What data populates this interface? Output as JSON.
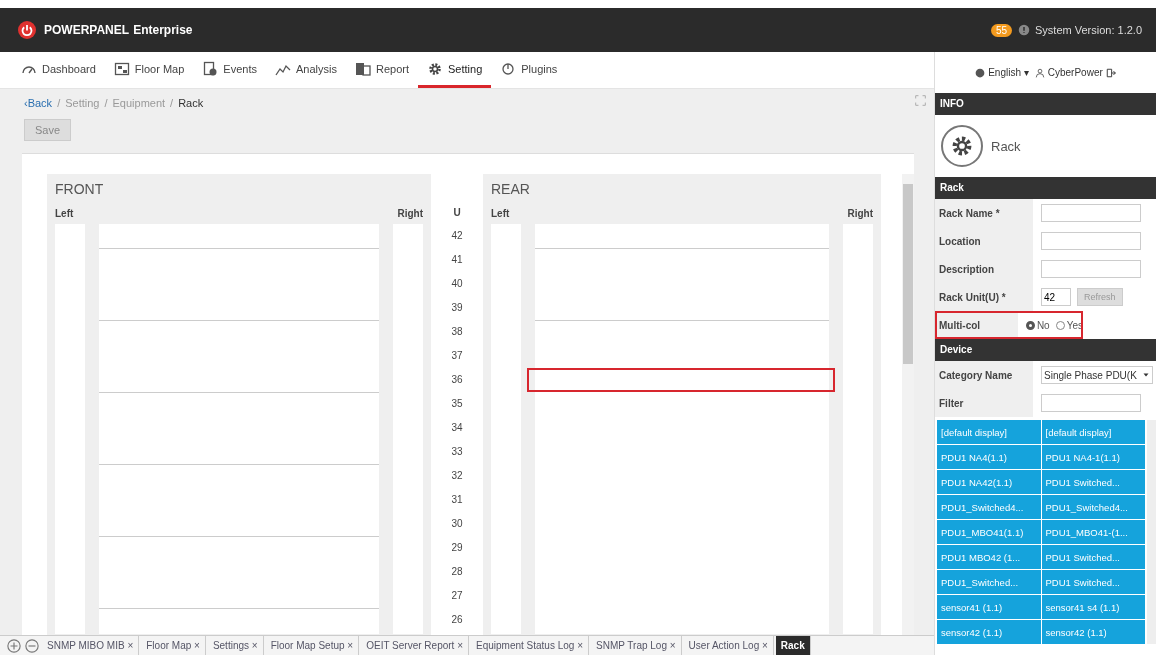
{
  "header": {
    "brand": "POWERPANEL",
    "brand_suffix": "Enterprise",
    "notifications": "55",
    "version": "System Version: 1.2.0"
  },
  "nav": {
    "items": [
      {
        "label": "Dashboard",
        "selected": false
      },
      {
        "label": "Floor Map",
        "selected": false
      },
      {
        "label": "Events",
        "selected": false
      },
      {
        "label": "Analysis",
        "selected": false
      },
      {
        "label": "Report",
        "selected": false
      },
      {
        "label": "Setting",
        "selected": true
      },
      {
        "label": "Plugins",
        "selected": false
      }
    ]
  },
  "breadcrumb": {
    "back": "‹Back",
    "path": [
      {
        "separator": "/",
        "label": "Setting"
      },
      {
        "separator": "/",
        "label": "Equipment"
      },
      {
        "separator": "/",
        "label": "Rack"
      }
    ]
  },
  "toolbar": {
    "save": "Save"
  },
  "rack": {
    "u_label": "U",
    "units": [
      "42",
      "41",
      "40",
      "39",
      "38",
      "37",
      "36",
      "35",
      "34",
      "33",
      "32",
      "31",
      "30",
      "29",
      "28",
      "27",
      "26"
    ],
    "front": {
      "title": "FRONT",
      "left": "Left",
      "right": "Right",
      "rows": [
        {
          "boundary": false,
          "selected": false
        },
        {
          "boundary": true,
          "selected": false
        },
        {
          "boundary": false,
          "selected": false
        },
        {
          "boundary": false,
          "selected": false
        },
        {
          "boundary": true,
          "selected": false
        },
        {
          "boundary": false,
          "selected": false
        },
        {
          "boundary": false,
          "selected": false
        },
        {
          "boundary": true,
          "selected": false
        },
        {
          "boundary": false,
          "selected": false
        },
        {
          "boundary": false,
          "selected": false
        },
        {
          "boundary": true,
          "selected": false
        },
        {
          "boundary": false,
          "selected": false
        },
        {
          "boundary": false,
          "selected": false
        },
        {
          "boundary": true,
          "selected": false
        },
        {
          "boundary": false,
          "selected": false
        },
        {
          "boundary": false,
          "selected": false
        },
        {
          "boundary": true,
          "selected": false
        }
      ]
    },
    "rear": {
      "title": "REAR",
      "left": "Left",
      "right": "Right",
      "rows": [
        {
          "boundary": false,
          "selected": false
        },
        {
          "boundary": true,
          "selected": false
        },
        {
          "boundary": false,
          "selected": false
        },
        {
          "boundary": false,
          "selected": false
        },
        {
          "boundary": true,
          "selected": false
        },
        {
          "boundary": false,
          "selected": false
        },
        {
          "boundary": false,
          "selected": true
        },
        {
          "boundary": false,
          "selected": false
        },
        {
          "boundary": false,
          "selected": false
        },
        {
          "boundary": false,
          "selected": false
        },
        {
          "boundary": false,
          "selected": false
        },
        {
          "boundary": false,
          "selected": false
        },
        {
          "boundary": false,
          "selected": false
        },
        {
          "boundary": false,
          "selected": false
        },
        {
          "boundary": false,
          "selected": false
        },
        {
          "boundary": false,
          "selected": false
        },
        {
          "boundary": false,
          "selected": false
        }
      ]
    }
  },
  "bottom_tabs": [
    {
      "label": "SNMP MIBO MIB ×",
      "selected": false
    },
    {
      "label": "Floor Map ×",
      "selected": false
    },
    {
      "label": "Settings ×",
      "selected": false
    },
    {
      "label": "Floor Map Setup ×",
      "selected": false
    },
    {
      "label": "OEIT Server Report ×",
      "selected": false
    },
    {
      "label": "Equipment Status Log ×",
      "selected": false
    },
    {
      "label": "SNMP Trap Log ×",
      "selected": false
    },
    {
      "label": "User Action Log ×",
      "selected": false
    },
    {
      "label": "Rack",
      "selected": true
    }
  ],
  "sidebar": {
    "language": "English ▾",
    "user": "CyberPower",
    "info_title": "INFO",
    "info_name": "Rack",
    "rack_title": "Rack",
    "fields": [
      {
        "kind": "text",
        "label": "Rack Name *"
      },
      {
        "kind": "text",
        "label": "Location"
      },
      {
        "kind": "text",
        "label": "Description"
      },
      {
        "kind": "unit",
        "label": "Rack Unit(U) *",
        "value": "42",
        "button": "Refresh",
        "disabled": true
      },
      {
        "kind": "radio",
        "label": "Multi-col",
        "highlighted": true,
        "options": [
          {
            "label": "No",
            "selected": true
          },
          {
            "label": "Yes",
            "selected": false
          }
        ]
      }
    ],
    "device_title": "Device",
    "category_label": "Category Name",
    "category_value": "Single Phase PDU(K",
    "filter_label": "Filter",
    "devices": [
      [
        "[default display]",
        "[default display]"
      ],
      [
        "PDU1 NA4(1.1)",
        "PDU1 NA4-1(1.1)"
      ],
      [
        "PDU1 NA42(1.1)",
        "PDU1 Switched..."
      ],
      [
        "PDU1_Switched4...",
        "PDU1_Switched4..."
      ],
      [
        "PDU1_MBO41(1.1)",
        "PDU1_MBO41-(1..."
      ],
      [
        "PDU1 MBO42 (1...",
        "PDU1 Switched..."
      ],
      [
        "PDU1_Switched...",
        "PDU1 Switched..."
      ],
      [
        "sensor41 (1.1)",
        "sensor41 s4 (1.1)"
      ],
      [
        "sensor42 (1.1)",
        "sensor42 (1.1)"
      ]
    ]
  }
}
